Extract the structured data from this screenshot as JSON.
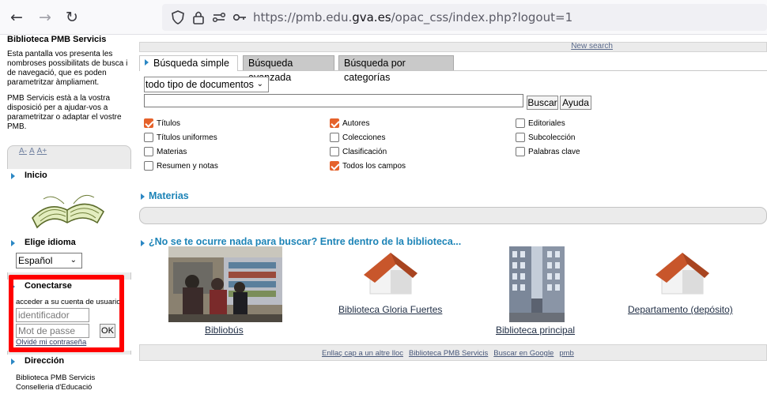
{
  "browser": {
    "url_prefix": "https://pmb.edu.",
    "url_domain": "gva.es",
    "url_suffix": "/opac_css/index.php?logout=1"
  },
  "sidebar": {
    "site_title": "Biblioteca PMB Servicis",
    "intro": "Esta pantalla vos presenta les nombroses possibilitats de busca i de navegació, que es poden parametritzar àmpliament.",
    "help": "PMB Servicis està a la vostra disposició per a ajudar-vos a parametritzar o adaptar el vostre PMB.",
    "font_sizes": [
      "A-",
      "A",
      "A+"
    ],
    "home": "Inicio",
    "language_title": "Elige idioma",
    "language_value": "Español",
    "login_title": "Conectarse",
    "login_text": "acceder a su cuenta de usuario",
    "username_placeholder": "identificador",
    "password_placeholder": "Mot de passe",
    "ok_label": "OK",
    "forgot_label": "Olvidé mi contraseña",
    "address_title": "Dirección",
    "address_line1": "Biblioteca PMB Servicis",
    "address_line2": "Conselleria d'Educació"
  },
  "main": {
    "new_search": "New search",
    "tabs": [
      "Búsqueda simple",
      "Búsqueda avanzada",
      "Búsqueda por categorías"
    ],
    "doc_type": "todo tipo de documentos",
    "search_button": "Buscar",
    "help_button": "Ayuda",
    "checkboxes": [
      {
        "label": "Títulos",
        "checked": true
      },
      {
        "label": "Títulos uniformes",
        "checked": false
      },
      {
        "label": "Materias",
        "checked": false
      },
      {
        "label": "Resumen y notas",
        "checked": false
      },
      {
        "label": "Autores",
        "checked": true
      },
      {
        "label": "Colecciones",
        "checked": false
      },
      {
        "label": "Clasificación",
        "checked": false
      },
      {
        "label": "Todos los campos",
        "checked": true
      },
      {
        "label": "Editoriales",
        "checked": false
      },
      {
        "label": "Subcolección",
        "checked": false
      },
      {
        "label": "Palabras clave",
        "checked": false
      }
    ],
    "materias_title": "Materias",
    "browse_title": "¿No se te ocurre nada para buscar? Entre dentro de la biblioteca...",
    "libraries": [
      "Bibliobús",
      "Biblioteca Gloria Fuertes",
      "Biblioteca principal",
      "Departamento (depósito)"
    ],
    "footer_links": [
      "Enllaç cap a un altre lloc",
      "Biblioteca PMB Servicis",
      "Buscar en Google",
      "pmb"
    ]
  },
  "colors": {
    "accent_blue": "#1d84b7",
    "checkbox_orange": "#e5622b",
    "highlight_red": "#ff0000",
    "roof_red": "#c8562b"
  }
}
